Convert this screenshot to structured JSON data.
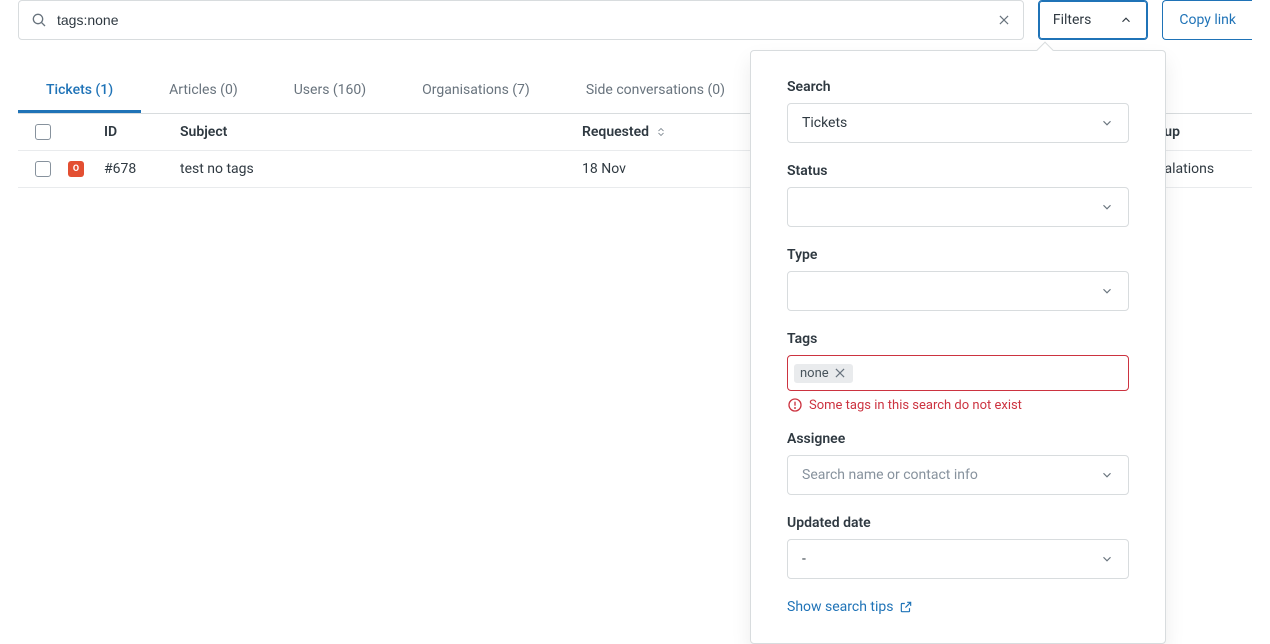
{
  "search": {
    "value": "tags:none"
  },
  "buttons": {
    "filters": "Filters",
    "copy_link": "Copy link"
  },
  "tabs": [
    {
      "label": "Tickets (1)",
      "active": true
    },
    {
      "label": "Articles (0)"
    },
    {
      "label": "Users (160)"
    },
    {
      "label": "Organisations (7)"
    },
    {
      "label": "Side conversations (0)"
    }
  ],
  "columns": {
    "id": "ID",
    "subject": "Subject",
    "requested": "Requested",
    "group": "Group"
  },
  "rows": [
    {
      "badge": "O",
      "id": "#678",
      "subject": "test no tags",
      "requested": "18 Nov",
      "group": "Escalations"
    }
  ],
  "panel": {
    "search": {
      "label": "Search",
      "value": "Tickets"
    },
    "status": {
      "label": "Status"
    },
    "type": {
      "label": "Type"
    },
    "tags": {
      "label": "Tags",
      "chip": "none",
      "error": "Some tags in this search do not exist"
    },
    "assignee": {
      "label": "Assignee",
      "placeholder": "Search name or contact info"
    },
    "updated": {
      "label": "Updated date",
      "value": "-"
    },
    "tips": "Show search tips"
  }
}
